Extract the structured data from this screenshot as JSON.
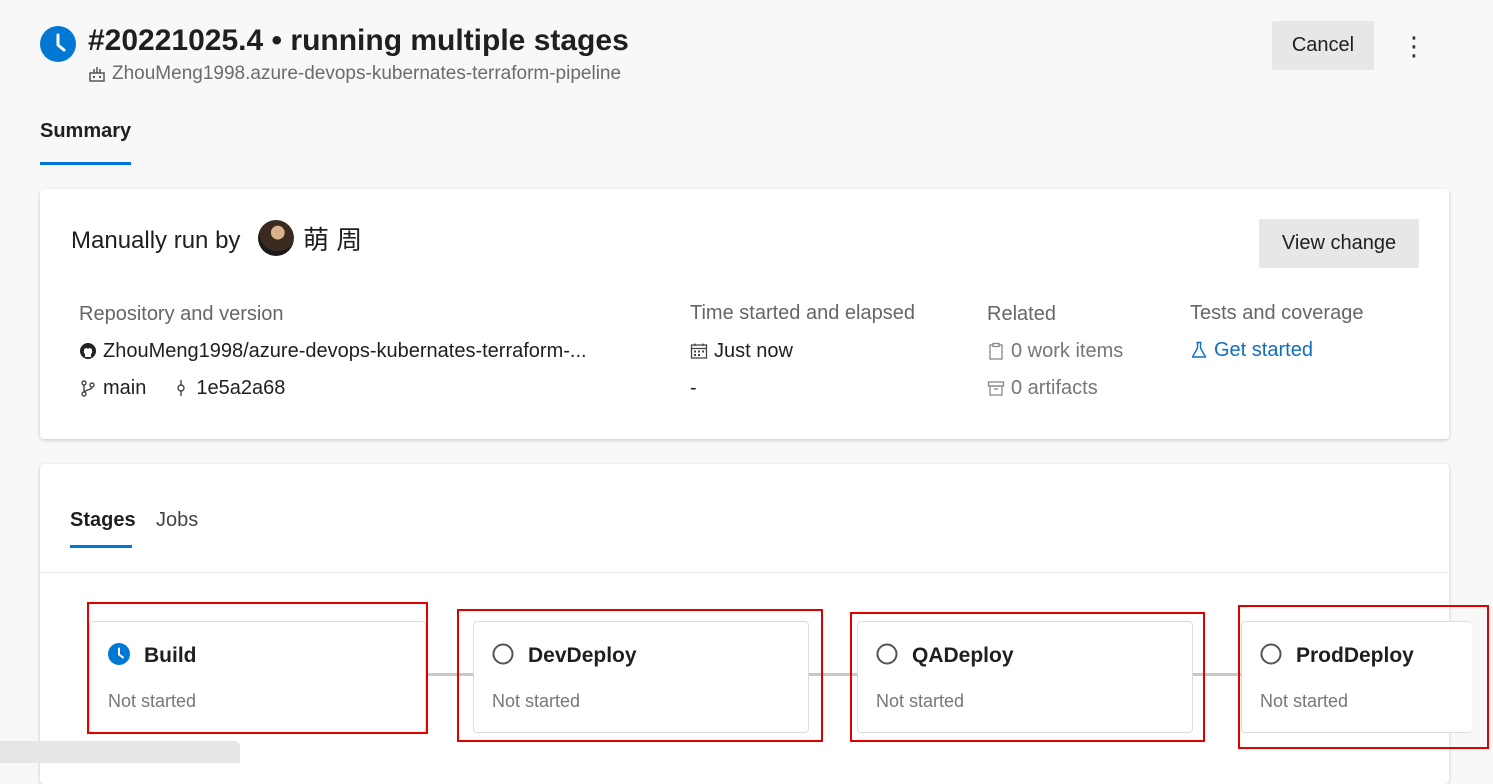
{
  "header": {
    "run_number": "#20221025.4",
    "separator": "•",
    "title": "running multiple stages",
    "repo_full": "ZhouMeng1998.azure-devops-kubernates-terraform-pipeline",
    "cancel_label": "Cancel",
    "more_label": "⋮"
  },
  "tabs": {
    "summary": "Summary"
  },
  "summary": {
    "manual_prefix": "Manually run by",
    "user_name": "萌 周",
    "view_change_label": "View change",
    "repo_heading": "Repository and version",
    "repo_name": "ZhouMeng1998/azure-devops-kubernates-terraform-...",
    "branch": "main",
    "commit": "1e5a2a68",
    "time_heading": "Time started and elapsed",
    "time_started": "Just now",
    "elapsed": "-",
    "related_heading": "Related",
    "work_items": "0 work items",
    "artifacts": "0 artifacts",
    "tests_heading": "Tests and coverage",
    "tests_link": "Get started"
  },
  "stage_tabs": {
    "stages": "Stages",
    "jobs": "Jobs"
  },
  "stages": [
    {
      "name": "Build",
      "status": "Not started",
      "state": "running"
    },
    {
      "name": "DevDeploy",
      "status": "Not started",
      "state": "pending"
    },
    {
      "name": "QADeploy",
      "status": "Not started",
      "state": "pending"
    },
    {
      "name": "ProdDeploy",
      "status": "Not started",
      "state": "pending"
    }
  ],
  "colors": {
    "accent": "#0078d4",
    "highlight": "#e00000",
    "link": "#106ebe"
  }
}
